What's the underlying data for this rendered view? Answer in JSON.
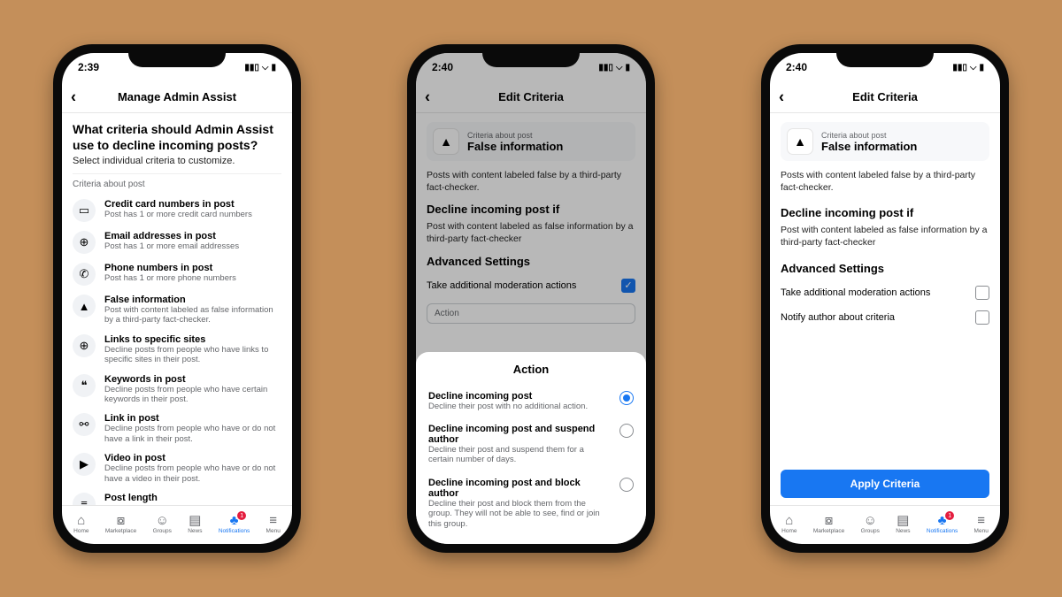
{
  "status": {
    "time1": "2:39",
    "time2": "2:40",
    "time3": "2:40"
  },
  "header": {
    "s1": "Manage Admin Assist",
    "s2": "Edit Criteria",
    "s3": "Edit Criteria"
  },
  "screen1": {
    "question": "What criteria should Admin Assist use to decline incoming posts?",
    "sub": "Select individual criteria to customize.",
    "section": "Criteria about post",
    "items": [
      {
        "t": "Credit card numbers in post",
        "d": "Post has 1 or more credit card numbers"
      },
      {
        "t": "Email addresses in post",
        "d": "Post has 1 or more email addresses"
      },
      {
        "t": "Phone numbers in post",
        "d": "Post has 1 or more phone numbers"
      },
      {
        "t": "False information",
        "d": "Post with content labeled as false information by a third-party fact-checker."
      },
      {
        "t": "Links to specific sites",
        "d": "Decline posts from people who have links to specific sites in their post."
      },
      {
        "t": "Keywords in post",
        "d": "Decline posts from people who have certain keywords in their post."
      },
      {
        "t": "Link in post",
        "d": "Decline posts from people who have or do not have a link in their post."
      },
      {
        "t": "Video in post",
        "d": "Decline posts from people who have or do not have a video in their post."
      },
      {
        "t": "Post length",
        "d": ""
      }
    ]
  },
  "editcard": {
    "label": "Criteria about post",
    "title": "False information"
  },
  "screen2": {
    "desc": "Posts with content labeled false by a third-party fact-checker.",
    "h_if": "Decline incoming post if",
    "if_desc": "Post with content labeled as false information by a third-party fact-checker",
    "h_adv": "Advanced Settings",
    "opt1": "Take additional moderation actions",
    "select_placeholder": "Action",
    "sheet_title": "Action",
    "actions": [
      {
        "t": "Decline incoming post",
        "d": "Decline their post with no additional action."
      },
      {
        "t": "Decline incoming post and suspend author",
        "d": "Decline their post and suspend them for a certain number of days."
      },
      {
        "t": "Decline incoming post and block author",
        "d": "Decline their post and block them from the group. They will not be able to see, find or join this group."
      }
    ]
  },
  "screen3": {
    "desc": "Posts with content labeled false by a third-party fact-checker.",
    "h_if": "Decline incoming post if",
    "if_desc": "Post with content labeled as false information by a third-party fact-checker",
    "h_adv": "Advanced Settings",
    "opt1": "Take additional moderation actions",
    "opt2": "Notify author about criteria",
    "apply": "Apply Criteria"
  },
  "tabs": [
    {
      "l": "Home"
    },
    {
      "l": "Marketplace"
    },
    {
      "l": "Groups"
    },
    {
      "l": "News"
    },
    {
      "l": "Notifications"
    },
    {
      "l": "Menu"
    }
  ],
  "badge": "1"
}
